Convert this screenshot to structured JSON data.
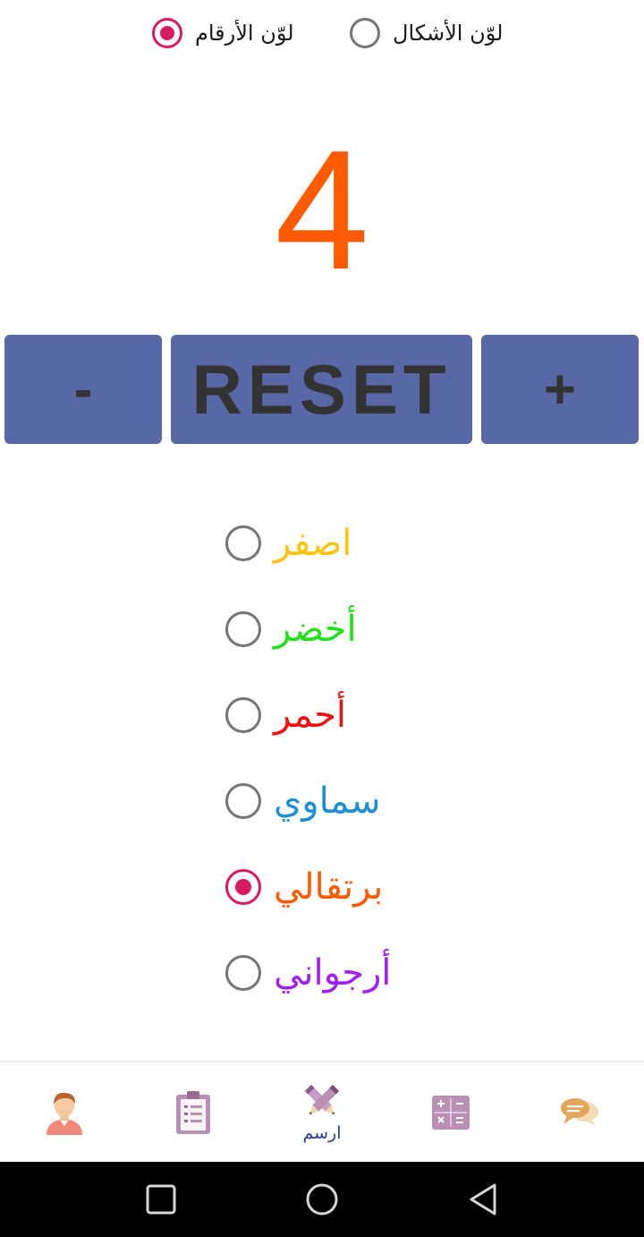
{
  "color_target": {
    "numbers_label": "لوّن الأرقام",
    "numbers_selected": true,
    "shapes_label": "لوّن الأشكال",
    "shapes_selected": false
  },
  "counter": {
    "value": "4",
    "color": "#ff5a00"
  },
  "buttons": {
    "minus": "-",
    "reset": "RESET",
    "plus": "+"
  },
  "colors": [
    {
      "label": "اصفر",
      "color": "#ffc20e",
      "selected": false
    },
    {
      "label": "أخضر",
      "color": "#22e11c",
      "selected": false
    },
    {
      "label": "أحمر",
      "color": "#ee1111",
      "selected": false
    },
    {
      "label": "سماوي",
      "color": "#1e8fd0",
      "selected": false
    },
    {
      "label": "برتقالي",
      "color": "#ff5a00",
      "selected": true
    },
    {
      "label": "أرجواني",
      "color": "#a020f0",
      "selected": false
    }
  ],
  "bottom_nav": {
    "items": [
      {
        "icon": "person-avatar-icon",
        "label": ""
      },
      {
        "icon": "clipboard-icon",
        "label": ""
      },
      {
        "icon": "pencil-draw-icon",
        "label": "ارسم",
        "active": true
      },
      {
        "icon": "calculator-icon",
        "label": ""
      },
      {
        "icon": "chat-bubbles-icon",
        "label": ""
      }
    ]
  },
  "system_nav": {
    "icons": [
      "recents-square-icon",
      "home-circle-icon",
      "back-triangle-icon"
    ]
  },
  "accent_color": "#d81b60",
  "button_color": "#5867a6"
}
